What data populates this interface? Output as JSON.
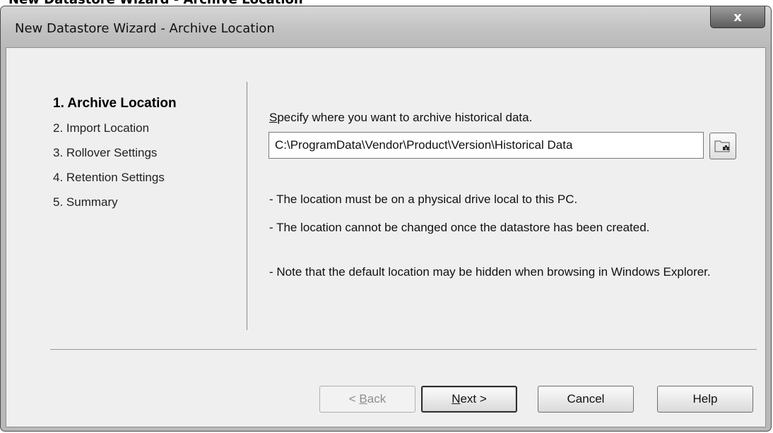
{
  "page_caption": "New Datastore Wizard - Archive Location",
  "window": {
    "title": "New Datastore Wizard - Archive Location",
    "close_glyph": "x"
  },
  "steps": [
    {
      "label": "1. Archive Location",
      "active": true
    },
    {
      "label": "2. Import Location",
      "active": false
    },
    {
      "label": "3. Rollover Settings",
      "active": false
    },
    {
      "label": "4. Retention Settings",
      "active": false
    },
    {
      "label": "5. Summary",
      "active": false
    }
  ],
  "content": {
    "heading_accel": "S",
    "heading_rest": "pecify where you want to archive historical data.",
    "path_value": "C:\\ProgramData\\Vendor\\Product\\Version\\Historical Data",
    "browse_icon": "folder-search-icon",
    "notes": [
      "- The location must be on a physical drive local to this PC.",
      "- The location cannot be changed once the datastore has been created.",
      "- Note that the default location may be hidden when browsing in Windows Explorer."
    ]
  },
  "buttons": {
    "back_pre": "< ",
    "back_accel": "B",
    "back_post": "ack",
    "next_accel": "N",
    "next_post": "ext >",
    "cancel": "Cancel",
    "help": "Help"
  }
}
